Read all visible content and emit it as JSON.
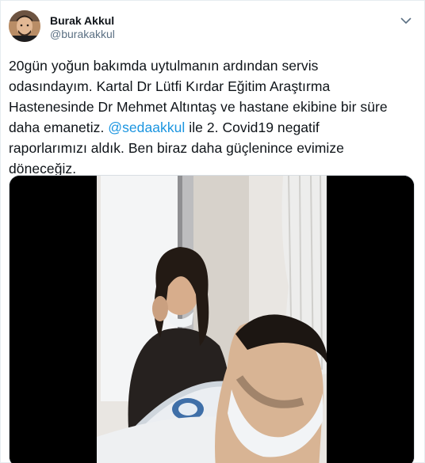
{
  "author": {
    "name": "Burak Akkul",
    "handle": "@burakakkul"
  },
  "tweet": {
    "line1": "20gün yoğun bakımda uytulmanın ardından servis",
    "line2": "odasındayım. Kartal Dr Lütfi Kırdar  Eğitim Araştırma",
    "line3": "Hastenesinde Dr Mehmet Altıntaş ve hastane ekibine bir süre",
    "line4_pre": "daha emanetiz. ",
    "mention": "@sedaakkul",
    "line4_post": " ile 2. Covid19 negatif",
    "line5": "raporlarımızı aldık. Ben biraz daha güçlenince evimize",
    "line6": "döneceğiz."
  },
  "icons": {
    "more": "chevron-down-icon",
    "avatar": "profile-photo"
  },
  "colors": {
    "mention": "#1b95e0",
    "handle": "#5b7083",
    "text": "#0f1419"
  }
}
